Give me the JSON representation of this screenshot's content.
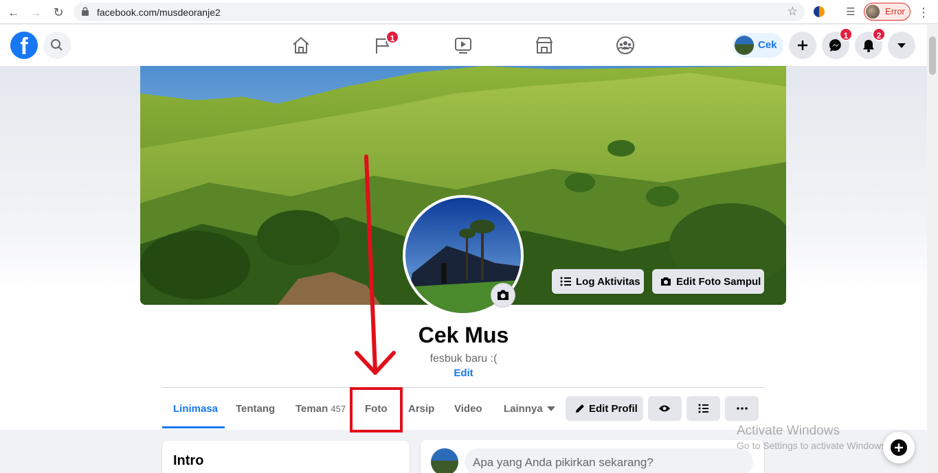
{
  "browser": {
    "url": "facebook.com/musdeoranje2",
    "profile_status": "Error"
  },
  "nav": {
    "logo": "f",
    "user_name": "Cek",
    "badges": {
      "pages": "1",
      "messenger": "1",
      "notifications": "2"
    }
  },
  "cover": {
    "activity_log_label": "Log Aktivitas",
    "edit_cover_label": "Edit Foto Sampul"
  },
  "profile": {
    "name": "Cek Mus",
    "bio": "fesbuk baru :(",
    "edit_bio_label": "Edit"
  },
  "tabs": [
    {
      "label": "Linimasa",
      "active": true
    },
    {
      "label": "Tentang"
    },
    {
      "label": "Teman",
      "count": "457"
    },
    {
      "label": "Foto"
    },
    {
      "label": "Arsip"
    },
    {
      "label": "Video"
    },
    {
      "label": "Lainnya"
    }
  ],
  "actions": {
    "edit_profile_label": "Edit Profil"
  },
  "intro": {
    "title": "Intro"
  },
  "composer": {
    "placeholder": "Apa yang Anda pikirkan sekarang?"
  },
  "watermark": {
    "title": "Activate Windows",
    "subtitle": "Go to Settings to activate Windows."
  },
  "colors": {
    "brand": "#1877f2",
    "badge": "#e41e3f",
    "annotation": "#e0101a"
  }
}
